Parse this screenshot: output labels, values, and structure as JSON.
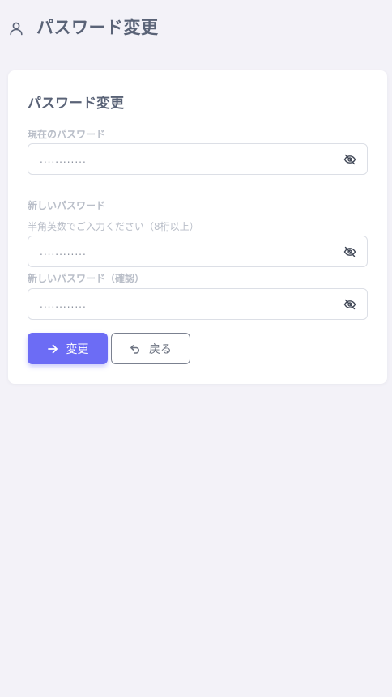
{
  "header": {
    "title": "パスワード変更",
    "icon": "user-icon"
  },
  "form": {
    "card_title": "パスワード変更",
    "current_password": {
      "label": "現在のパスワード",
      "value": "............",
      "toggle_icon": "eye-off-icon"
    },
    "new_password": {
      "label": "新しいパスワード",
      "hint": "半角英数でご入力ください（8桁以上）",
      "value": "............",
      "toggle_icon": "eye-off-icon"
    },
    "confirm_password": {
      "label": "新しいパスワード（確認）",
      "value": "............",
      "toggle_icon": "eye-off-icon"
    }
  },
  "actions": {
    "submit_label": "変更",
    "submit_icon": "arrow-right-icon",
    "back_label": "戻る",
    "back_icon": "undo-icon"
  },
  "colors": {
    "background": "#f3f2f8",
    "primary": "#6c6cf5",
    "card": "#ffffff"
  }
}
